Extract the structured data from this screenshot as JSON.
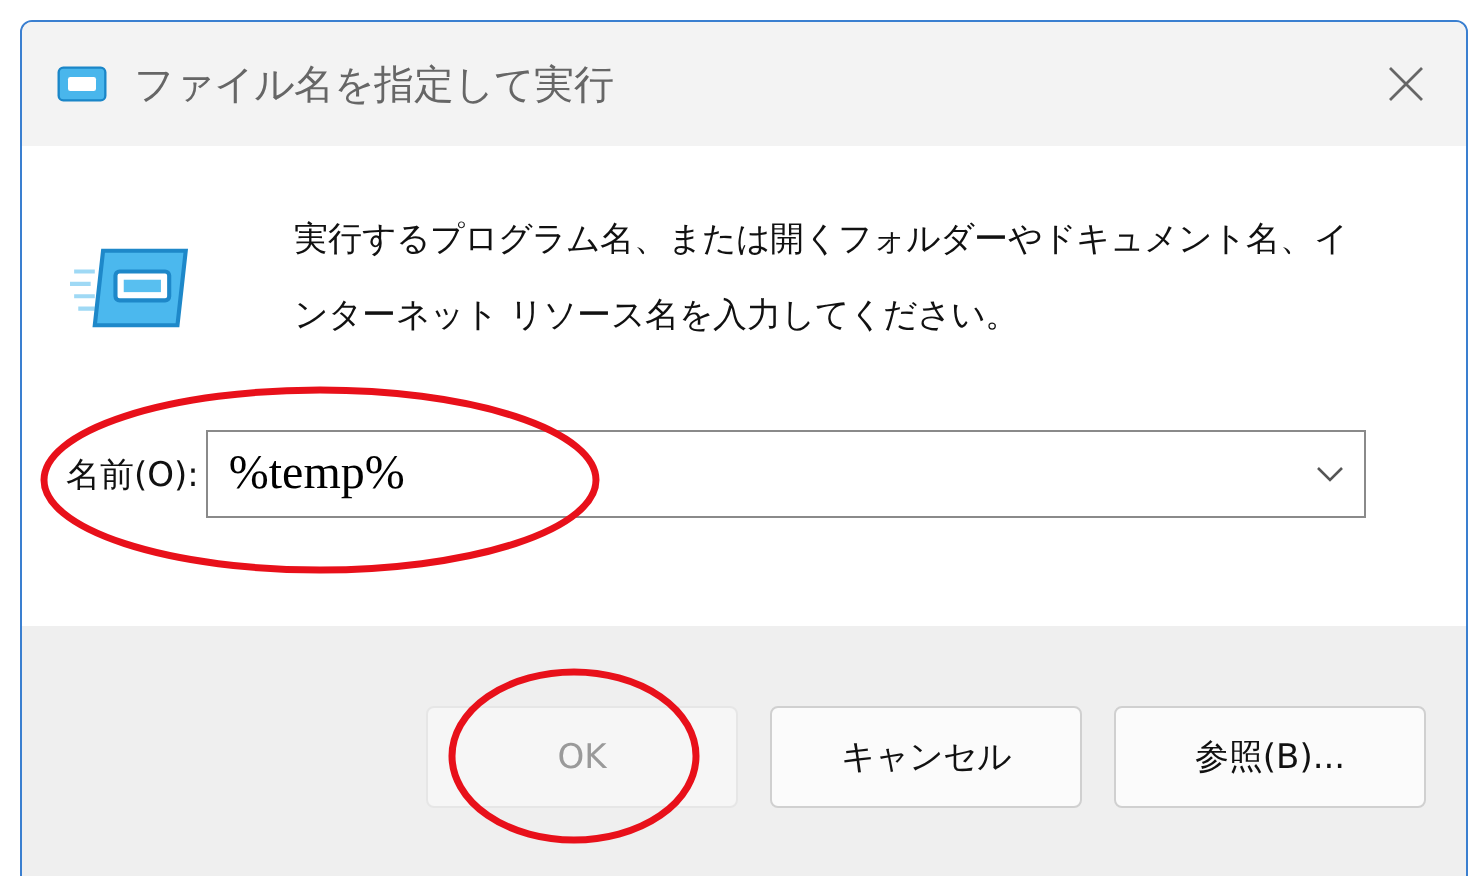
{
  "window": {
    "title": "ファイル名を指定して実行"
  },
  "description": [
    "実行するプログラム名、または開くフォルダーやドキュメント名、イ",
    "ンターネット リソース名を入力してください。"
  ],
  "name_field": {
    "label": "名前(O):",
    "value": "%temp%"
  },
  "buttons": [
    {
      "label": "OK",
      "disabled": true
    },
    {
      "label": "キャンセル",
      "disabled": false
    },
    {
      "label": "参照(B)...",
      "disabled": false
    }
  ],
  "annotations": [
    {
      "kind": "ellipse"
    },
    {
      "kind": "ellipse"
    }
  ]
}
